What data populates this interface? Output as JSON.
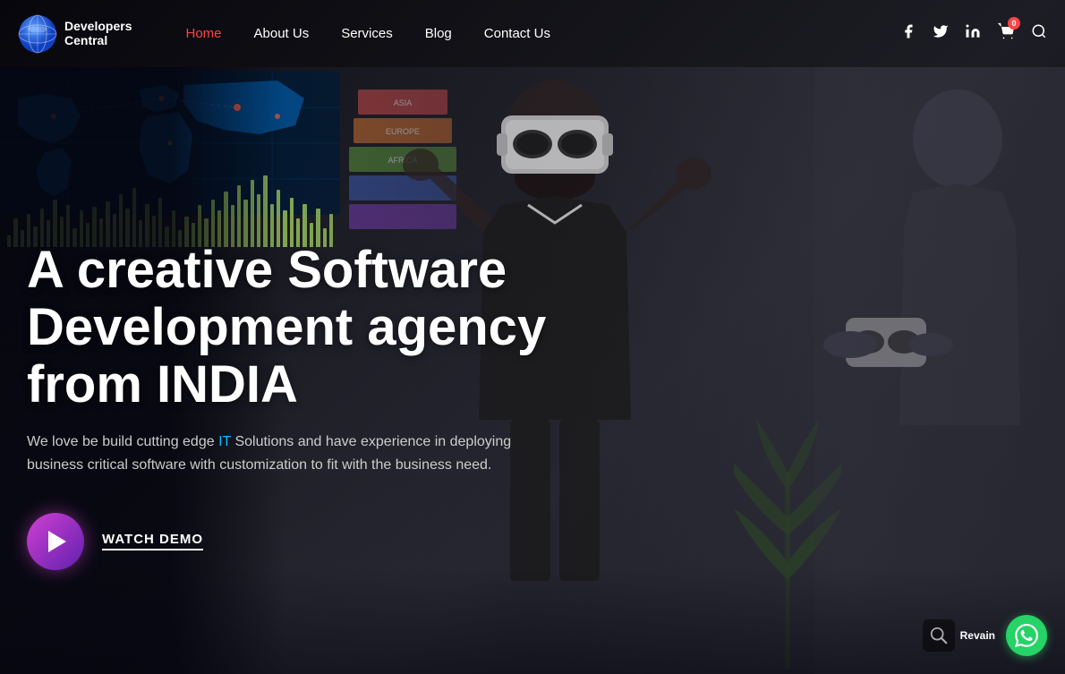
{
  "site": {
    "name_line1": "Developers",
    "name_line2": "Central"
  },
  "nav": {
    "links": [
      {
        "id": "home",
        "label": "Home",
        "active": true
      },
      {
        "id": "about",
        "label": "About Us",
        "active": false
      },
      {
        "id": "services",
        "label": "Services",
        "active": false
      },
      {
        "id": "blog",
        "label": "Blog",
        "active": false
      },
      {
        "id": "contact",
        "label": "Contact Us",
        "active": false
      }
    ],
    "cart_count": "0",
    "icons": [
      "facebook",
      "twitter",
      "linkedin",
      "cart",
      "search"
    ]
  },
  "hero": {
    "title": "A creative Software Development agency from INDIA",
    "subtitle": "We love be build cutting edge IT Solutions and have experience in deploying business critical software with customization to fit with the business need.",
    "highlight_word": "IT",
    "cta_label": "WATCH DEMO"
  },
  "bottom": {
    "revain_label": "Revain",
    "whatsapp_label": "WhatsApp"
  },
  "bars": [
    12,
    30,
    18,
    35,
    22,
    40,
    28,
    50,
    32,
    44,
    20,
    38,
    25,
    42,
    30,
    48,
    35,
    55,
    40,
    62,
    28,
    45,
    33,
    52,
    22,
    38,
    18,
    32,
    25,
    44,
    30,
    50,
    38,
    58,
    44,
    65,
    50,
    70,
    55,
    75,
    45,
    60,
    38,
    52,
    30,
    45,
    25,
    40,
    20,
    35
  ],
  "colors": {
    "accent_red": "#ff4444",
    "accent_blue": "#00bfff",
    "nav_active": "#ff4444",
    "logo_gradient_start": "#3060e0",
    "logo_gradient_end": "#1090e0",
    "play_gradient_start": "#d040d0",
    "play_gradient_end": "#6020b0",
    "whatsapp_green": "#25d366",
    "bar_color": "#a0d060"
  }
}
